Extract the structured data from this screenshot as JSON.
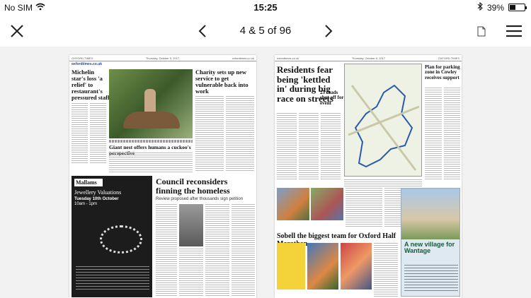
{
  "status": {
    "carrier": "No SIM",
    "time": "15:25",
    "battery_percent": "39%",
    "battery_level": 0.39
  },
  "toolbar": {
    "page_counter": "4 & 5 of 96"
  },
  "left_page": {
    "header_left": "OXFORD TIMES",
    "header_date": "Thursday, October 5, 2017",
    "header_site": "oxfordtimes.co.uk",
    "masthead": "oxfordtimes.co.uk",
    "story1_headline": "Michelin star's loss 'a relief' to restaurant's pressured staff",
    "story2_headline": "Charity sets up new service to get vulnerable back into work",
    "story3_headline": "Giant nest offers humans a cuckoo's perspective",
    "story4_headline": "Council reconsiders finning the homeless",
    "story4_standfirst": "Review proposed after thousands sign petition",
    "ad_brand": "Mallams",
    "ad_title": "Jewellery Valuations",
    "ad_date": "Tuesday 10th October",
    "ad_time": "10am - 1pm"
  },
  "right_page": {
    "header_site": "oxfordtimes.co.uk",
    "header_date": "Thursday, October 5, 2017",
    "header_right": "OXFORD TIMES",
    "story1_headline": "Residents fear being 'kettled in' during big race on streets",
    "story1_subhead": "25 roads shut off for event",
    "story2_headline": "Plan for parking zone in Cowley receives support",
    "story3_headline": "Sobell the biggest team for Oxford Half Marathon",
    "ad_title": "A new village for Wantage"
  }
}
